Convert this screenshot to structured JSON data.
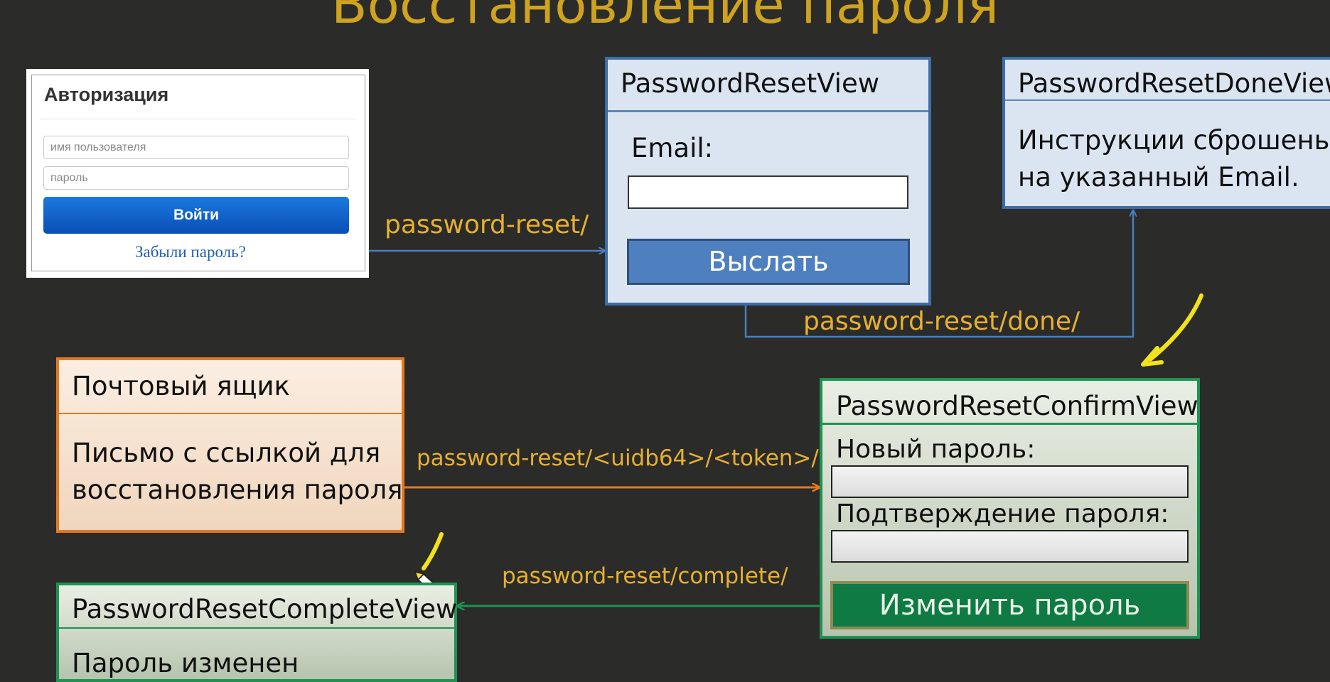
{
  "title": "Восстановление пароля",
  "login_form": {
    "heading": "Авторизация",
    "username_placeholder": "имя пользователя",
    "password_placeholder": "пароль",
    "submit_label": "Войти",
    "forgot_link": "Забыли пароль?"
  },
  "password_reset_view": {
    "name": "PasswordResetView",
    "email_label": "Email:",
    "email_value": "",
    "send_button": "Выслать"
  },
  "password_reset_done_view": {
    "name": "PasswordResetDoneView",
    "text_line1": "Инструкции сброшены",
    "text_line2": "на указанный Email."
  },
  "mailbox": {
    "name": "Почтовый ящик",
    "text_line1": "Письмо с ссылкой для",
    "text_line2": "восстановления пароля"
  },
  "password_reset_confirm_view": {
    "name": "PasswordResetConfirmView",
    "new_password_label": "Новый пароль:",
    "confirm_password_label": "Подтверждение пароля:",
    "change_button": "Изменить пароль"
  },
  "password_reset_complete_view": {
    "name": "PasswordResetCompleteView",
    "text": "Пароль изменен"
  },
  "urls": {
    "reset": "password-reset/",
    "done": "password-reset/done/",
    "confirm": "password-reset/<uidb64>/<token>/",
    "complete": "password-reset/complete/"
  },
  "colors": {
    "background": "#2b2b2a",
    "title": "#cfa31f",
    "url_text": "#e7b030",
    "blue_arrow": "#4a7fc0",
    "orange_arrow": "#e6791f",
    "green_arrow": "#1c9350",
    "annotation": "#f2e21b"
  }
}
